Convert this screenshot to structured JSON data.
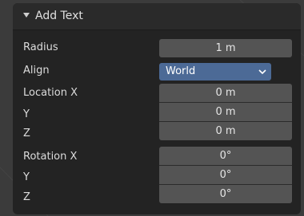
{
  "panel": {
    "title": "Add Text",
    "expanded": true
  },
  "radius": {
    "label": "Radius",
    "value": "1 m"
  },
  "align": {
    "label": "Align",
    "value": "World",
    "accent": "#4c6a96"
  },
  "location": {
    "label_x": "Location X",
    "label_y": "Y",
    "label_z": "Z",
    "x": "0 m",
    "y": "0 m",
    "z": "0 m"
  },
  "rotation": {
    "label_x": "Rotation X",
    "label_y": "Y",
    "label_z": "Z",
    "x": "0°",
    "y": "0°",
    "z": "0°"
  },
  "icons": {
    "collapse": "triangle-down",
    "dropdown": "chevron-down"
  }
}
